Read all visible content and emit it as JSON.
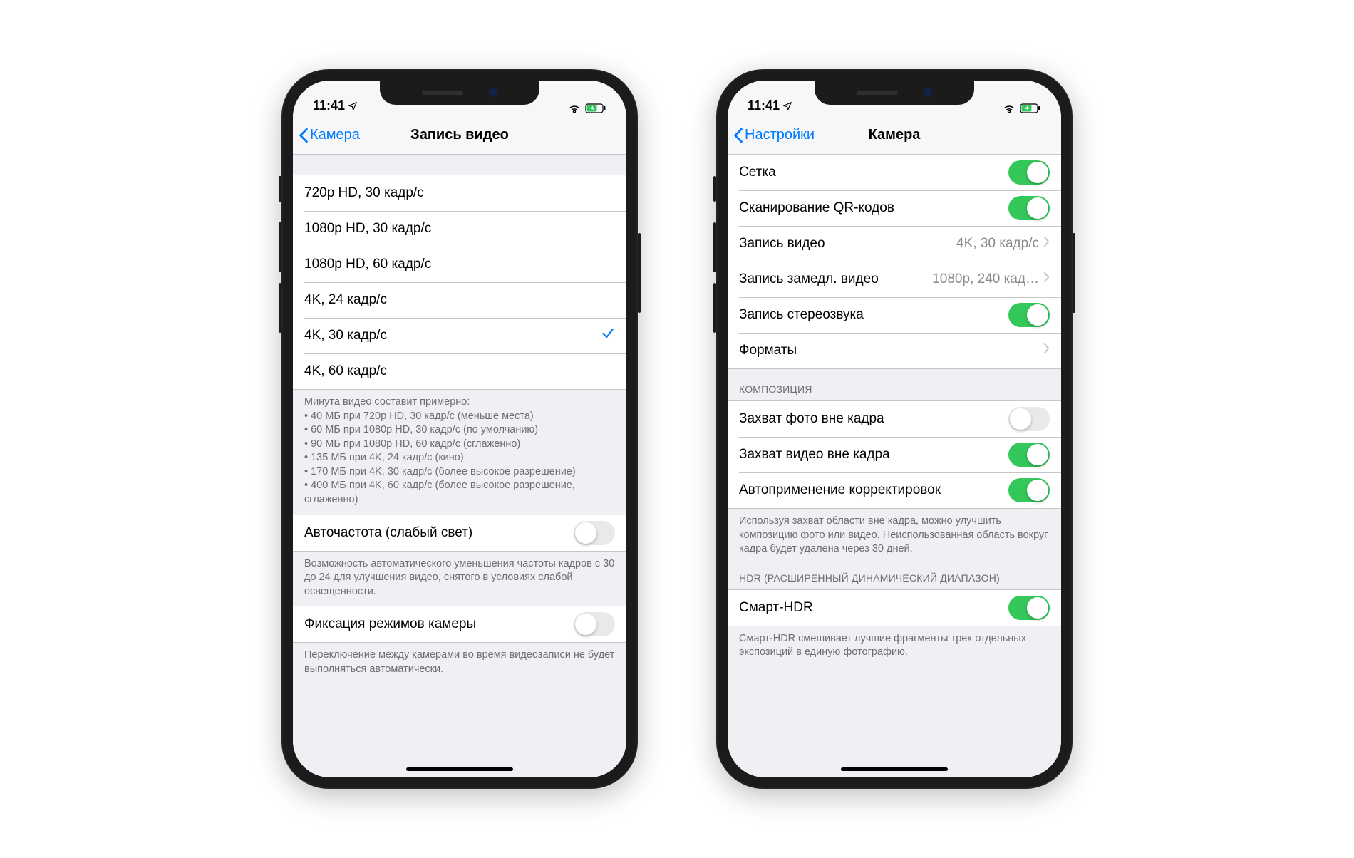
{
  "status": {
    "time": "11:41"
  },
  "phone1": {
    "back": "Камера",
    "title": "Запись видео",
    "options": [
      "720p HD, 30 кадр/с",
      "1080p HD, 30 кадр/с",
      "1080p HD, 60 кадр/с",
      "4K, 24 кадр/с",
      "4K, 30 кадр/с",
      "4K, 60 кадр/с"
    ],
    "selected_index": 4,
    "size_note_header": "Минута видео составит примерно:",
    "size_notes": [
      "• 40 МБ при 720p HD, 30 кадр/с (меньше места)",
      "• 60 МБ при 1080p HD, 30 кадр/с (по умолчанию)",
      "• 90 МБ при 1080p HD, 60 кадр/с (сглаженно)",
      "• 135 МБ при 4K, 24 кадр/с (кино)",
      "• 170 МБ при 4K, 30 кадр/с (более высокое разрешение)",
      "• 400 МБ при 4K, 60 кадр/с (более высокое разрешение, сглаженно)"
    ],
    "auto_fps": {
      "label": "Авточастота (слабый свет)",
      "on": false,
      "footer": "Возможность автоматического уменьшения частоты кадров с 30 до 24 для улучшения видео, снятого в условиях слабой освещенности."
    },
    "lock_camera": {
      "label": "Фиксация режимов камеры",
      "on": false,
      "footer": "Переключение между камерами во время видеозаписи не будет выполняться автоматически."
    }
  },
  "phone2": {
    "back": "Настройки",
    "title": "Камера",
    "rows1": {
      "grid": {
        "label": "Сетка",
        "on": true
      },
      "qr": {
        "label": "Сканирование QR-кодов",
        "on": true
      },
      "record_video": {
        "label": "Запись видео",
        "value": "4K, 30 кадр/с"
      },
      "record_slomo": {
        "label": "Запись замедл. видео",
        "value": "1080p, 240 кад…"
      },
      "stereo": {
        "label": "Запись стереозвука",
        "on": true
      },
      "formats": {
        "label": "Форматы"
      }
    },
    "section_composition": "КОМПОЗИЦИЯ",
    "rows2": {
      "photo_outside": {
        "label": "Захват фото вне кадра",
        "on": false
      },
      "video_outside": {
        "label": "Захват видео вне кадра",
        "on": true
      },
      "auto_apply": {
        "label": "Автоприменение корректировок",
        "on": true
      }
    },
    "composition_footer": "Используя захват области вне кадра, можно улучшить композицию фото или видео. Неиспользованная область вокруг кадра будет удалена через 30 дней.",
    "section_hdr": "HDR (РАСШИРЕННЫЙ ДИНАМИЧЕСКИЙ ДИАПАЗОН)",
    "smart_hdr": {
      "label": "Смарт-HDR",
      "on": true
    },
    "hdr_footer": "Смарт-HDR смешивает лучшие фрагменты трех отдельных экспозиций в единую фотографию."
  }
}
